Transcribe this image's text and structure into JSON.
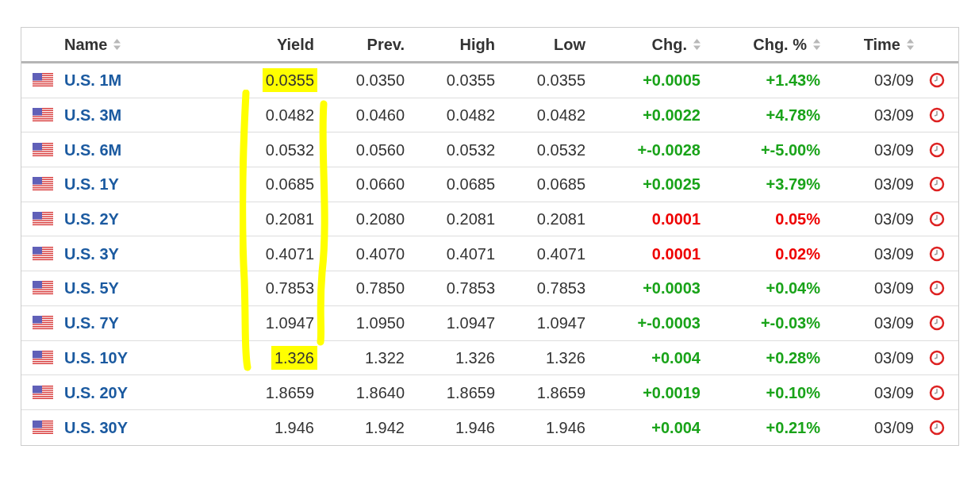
{
  "table": {
    "columns": [
      {
        "label": "Name",
        "sortable": true
      },
      {
        "label": "Yield",
        "sortable": false
      },
      {
        "label": "Prev.",
        "sortable": false
      },
      {
        "label": "High",
        "sortable": false
      },
      {
        "label": "Low",
        "sortable": false
      },
      {
        "label": "Chg.",
        "sortable": true
      },
      {
        "label": "Chg. %",
        "sortable": true
      },
      {
        "label": "Time",
        "sortable": true
      }
    ],
    "rows": [
      {
        "name": "U.S. 1M",
        "yield": "0.0355",
        "highlighted": true,
        "prev": "0.0350",
        "high": "0.0355",
        "low": "0.0355",
        "chg": "+0.0005",
        "chg_pct": "+1.43%",
        "color": "#19a319",
        "time": "03/09"
      },
      {
        "name": "U.S. 3M",
        "yield": "0.0482",
        "highlighted": false,
        "prev": "0.0460",
        "high": "0.0482",
        "low": "0.0482",
        "chg": "+0.0022",
        "chg_pct": "+4.78%",
        "color": "#19a319",
        "time": "03/09"
      },
      {
        "name": "U.S. 6M",
        "yield": "0.0532",
        "highlighted": false,
        "prev": "0.0560",
        "high": "0.0532",
        "low": "0.0532",
        "chg": "+-0.0028",
        "chg_pct": "+-5.00%",
        "color": "#19a319",
        "time": "03/09"
      },
      {
        "name": "U.S. 1Y",
        "yield": "0.0685",
        "highlighted": false,
        "prev": "0.0660",
        "high": "0.0685",
        "low": "0.0685",
        "chg": "+0.0025",
        "chg_pct": "+3.79%",
        "color": "#19a319",
        "time": "03/09"
      },
      {
        "name": "U.S. 2Y",
        "yield": "0.2081",
        "highlighted": false,
        "prev": "0.2080",
        "high": "0.2081",
        "low": "0.2081",
        "chg": "0.0001",
        "chg_pct": "0.05%",
        "color": "#ee0000",
        "time": "03/09"
      },
      {
        "name": "U.S. 3Y",
        "yield": "0.4071",
        "highlighted": false,
        "prev": "0.4070",
        "high": "0.4071",
        "low": "0.4071",
        "chg": "0.0001",
        "chg_pct": "0.02%",
        "color": "#ee0000",
        "time": "03/09"
      },
      {
        "name": "U.S. 5Y",
        "yield": "0.7853",
        "highlighted": false,
        "prev": "0.7850",
        "high": "0.7853",
        "low": "0.7853",
        "chg": "+0.0003",
        "chg_pct": "+0.04%",
        "color": "#19a319",
        "time": "03/09"
      },
      {
        "name": "U.S. 7Y",
        "yield": "1.0947",
        "highlighted": false,
        "prev": "1.0950",
        "high": "1.0947",
        "low": "1.0947",
        "chg": "+-0.0003",
        "chg_pct": "+-0.03%",
        "color": "#19a319",
        "time": "03/09"
      },
      {
        "name": "U.S. 10Y",
        "yield": "1.326",
        "highlighted": true,
        "prev": "1.322",
        "high": "1.326",
        "low": "1.326",
        "chg": "+0.004",
        "chg_pct": "+0.28%",
        "color": "#19a319",
        "time": "03/09"
      },
      {
        "name": "U.S. 20Y",
        "yield": "1.8659",
        "highlighted": false,
        "prev": "1.8640",
        "high": "1.8659",
        "low": "1.8659",
        "chg": "+0.0019",
        "chg_pct": "+0.10%",
        "color": "#19a319",
        "time": "03/09"
      },
      {
        "name": "U.S. 30Y",
        "yield": "1.946",
        "highlighted": false,
        "prev": "1.942",
        "high": "1.946",
        "low": "1.946",
        "chg": "+0.004",
        "chg_pct": "+0.21%",
        "color": "#19a319",
        "time": "03/09"
      }
    ]
  }
}
